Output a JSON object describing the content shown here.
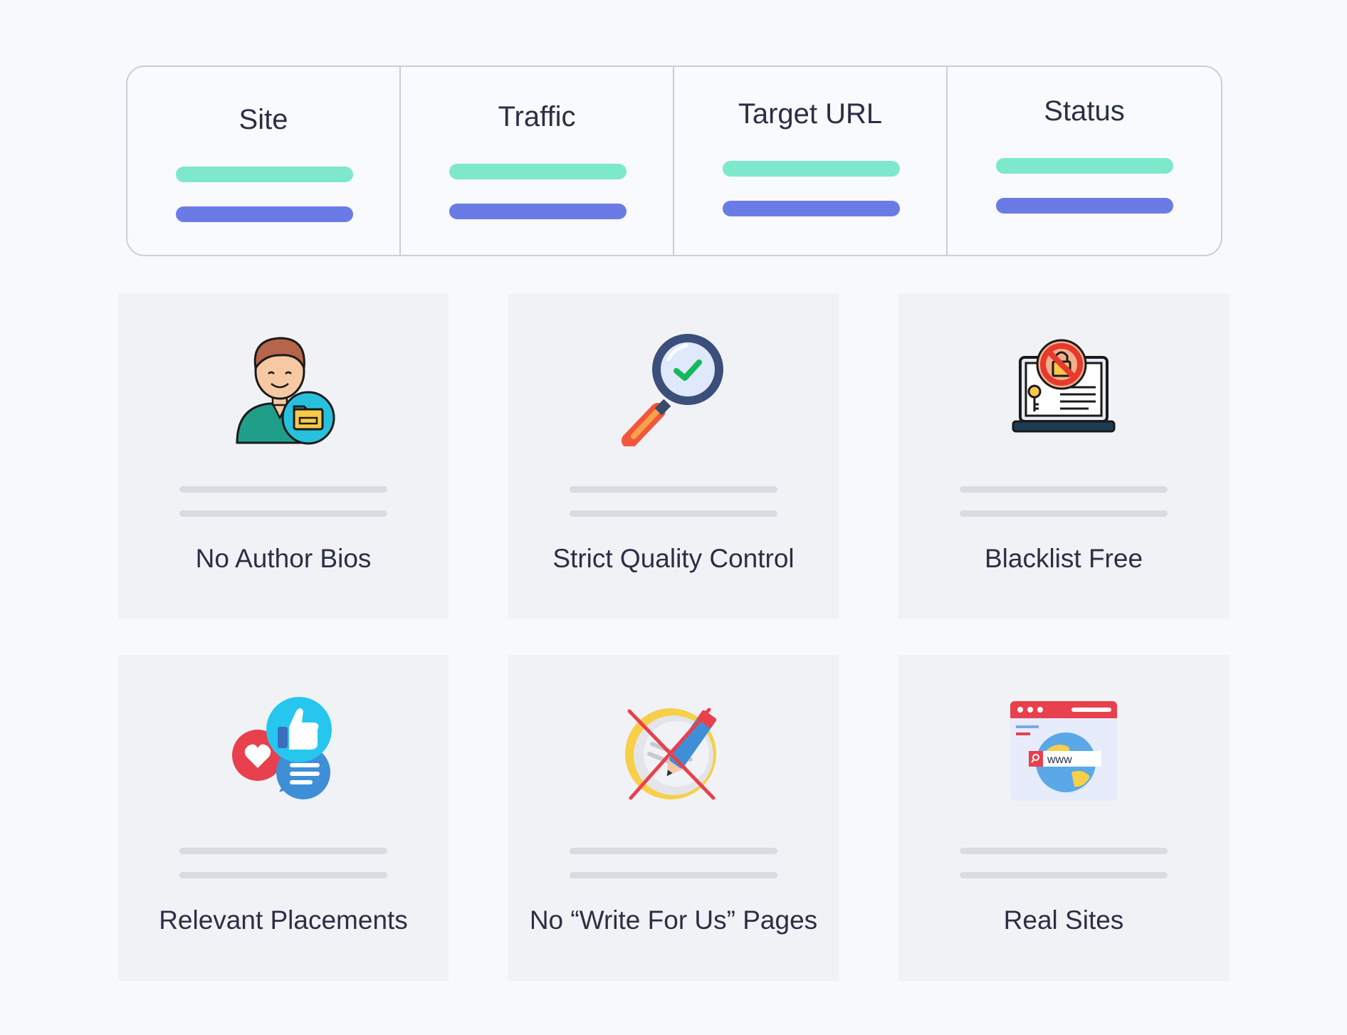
{
  "table": {
    "columns": [
      {
        "title": "Site"
      },
      {
        "title": "Traffic"
      },
      {
        "title": "Target URL"
      },
      {
        "title": "Status"
      }
    ],
    "bar_colors": {
      "primary": "#7de8cc",
      "secondary": "#6b7be6"
    }
  },
  "features": [
    {
      "label": "No Author Bios",
      "icon": "author-folder-icon"
    },
    {
      "label": "Strict Quality Control",
      "icon": "magnifier-check-icon"
    },
    {
      "label": "Blacklist Free",
      "icon": "laptop-blocked-icon"
    },
    {
      "label": "Relevant Placements",
      "icon": "social-thumbs-up-icon"
    },
    {
      "label": "No “Write For Us” Pages",
      "icon": "no-writing-icon"
    },
    {
      "label": "Real Sites",
      "icon": "browser-globe-www-icon"
    }
  ],
  "icon_text": {
    "www": "www"
  }
}
